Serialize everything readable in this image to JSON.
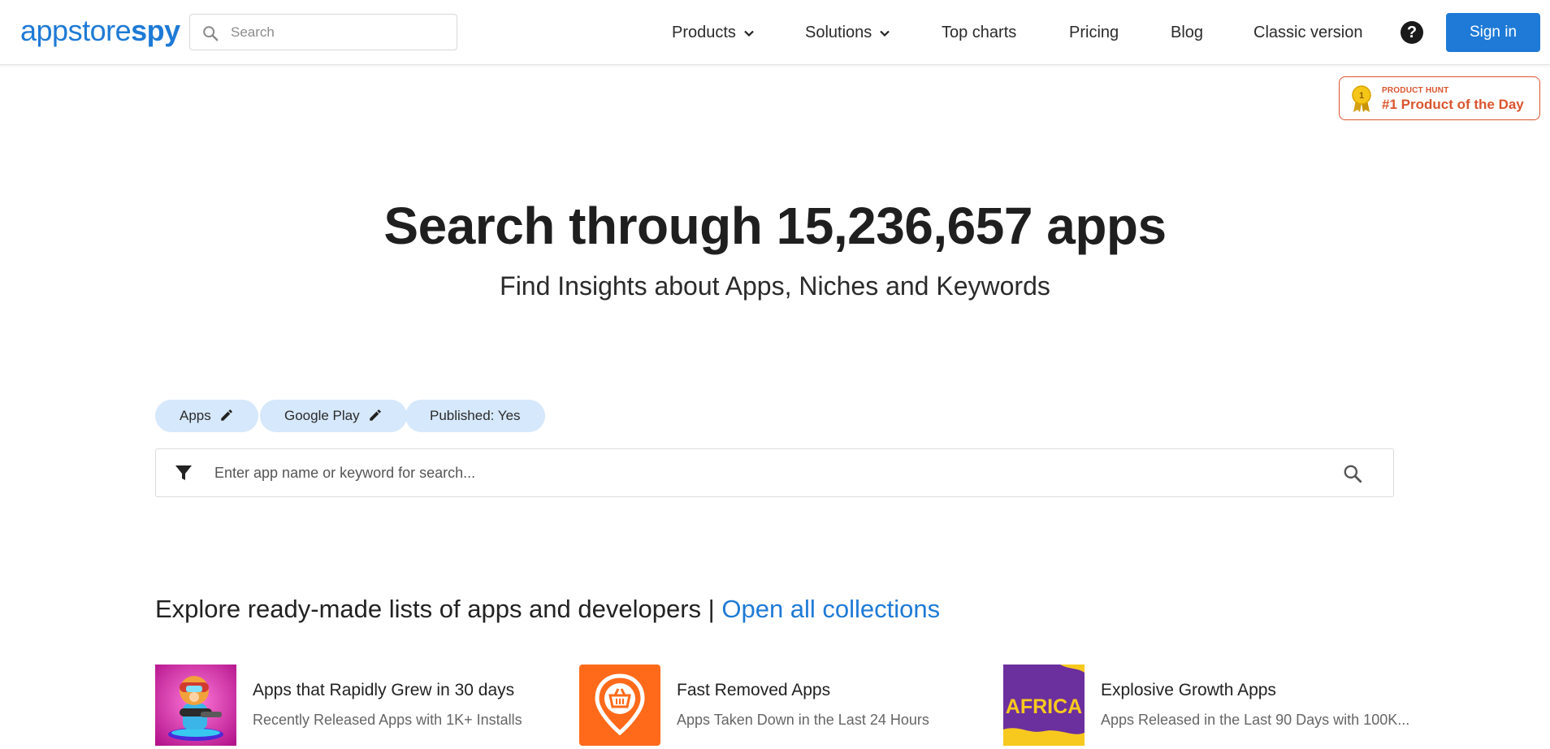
{
  "header": {
    "logo": {
      "part1": "appstore",
      "part2": "spy"
    },
    "search_placeholder": "Search",
    "nav": [
      {
        "label": "Products",
        "has_dropdown": true
      },
      {
        "label": "Solutions",
        "has_dropdown": true
      },
      {
        "label": "Top charts"
      },
      {
        "label": "Pricing"
      },
      {
        "label": "Blog"
      },
      {
        "label": "Classic version"
      }
    ],
    "help_icon": "question-circle-icon",
    "signin_label": "Sign in"
  },
  "badge": {
    "medal_number": "1",
    "small_text": "PRODUCT HUNT",
    "big_text": "#1 Product of the Day"
  },
  "hero": {
    "title": "Search through 15,236,657 apps",
    "subtitle": "Find Insights about Apps, Niches and Keywords"
  },
  "filters": {
    "chips": [
      {
        "label": "Apps",
        "editable": true
      },
      {
        "label": "Google Play",
        "editable": true
      },
      {
        "label": "Published: Yes",
        "editable": false
      }
    ],
    "search_placeholder": "Enter app name or keyword for search..."
  },
  "explore": {
    "text": "Explore ready-made lists of apps and developers |",
    "link": "Open all collections"
  },
  "collections": [
    {
      "title": "Apps that Rapidly Grew in 30 days",
      "subtitle": "Recently Released Apps with 1K+ Installs"
    },
    {
      "title": "Fast Removed Apps",
      "subtitle": "Apps Taken Down in the Last 24 Hours"
    },
    {
      "title": "Explosive Growth Apps",
      "subtitle": "Apps Released in the Last 90 Days with 100K...",
      "thumb_text": "AFRICA"
    }
  ],
  "colors": {
    "brand_blue": "#1e7ad6",
    "chip_bg": "#d6e8fb",
    "product_hunt": "#da552f"
  }
}
